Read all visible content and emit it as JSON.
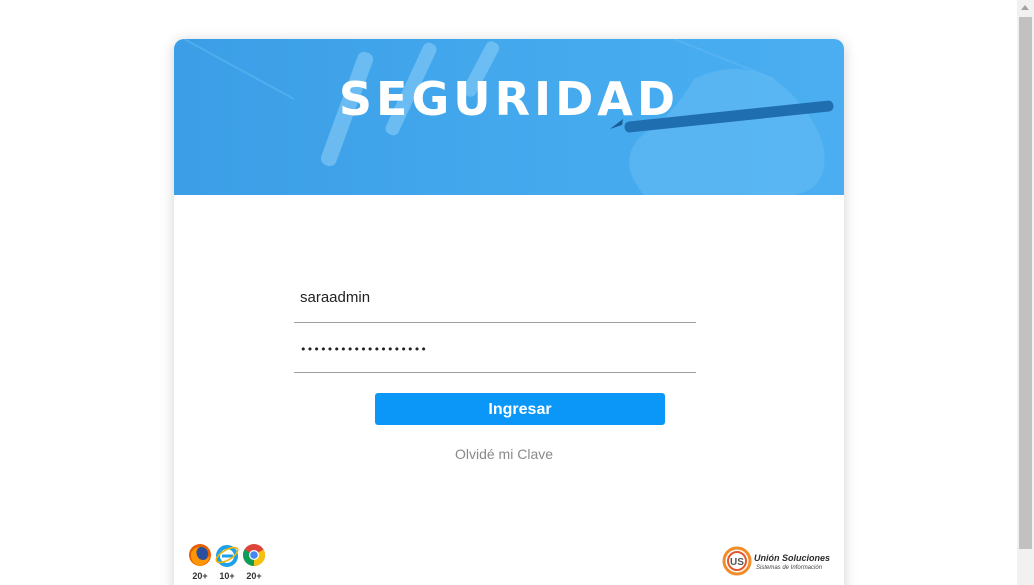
{
  "app": {
    "brand_title": "SEGURIDAD"
  },
  "login": {
    "username_value": "saraadmin",
    "password_masked": "•••••••••••••••••••",
    "submit_label": "Ingresar",
    "forgot_label": "Olvidé mi Clave"
  },
  "browsers": [
    {
      "icon": "firefox-icon",
      "version": "20+"
    },
    {
      "icon": "internet-explorer-icon",
      "version": "10+"
    },
    {
      "icon": "chrome-icon",
      "version": "20+"
    }
  ],
  "company": {
    "logo_text": "US",
    "name": "Unión Soluciones",
    "tagline": "Sistemas de Información"
  },
  "colors": {
    "banner": "#45a9ee",
    "button": "#0b97f7",
    "link": "#8a8a8a"
  }
}
